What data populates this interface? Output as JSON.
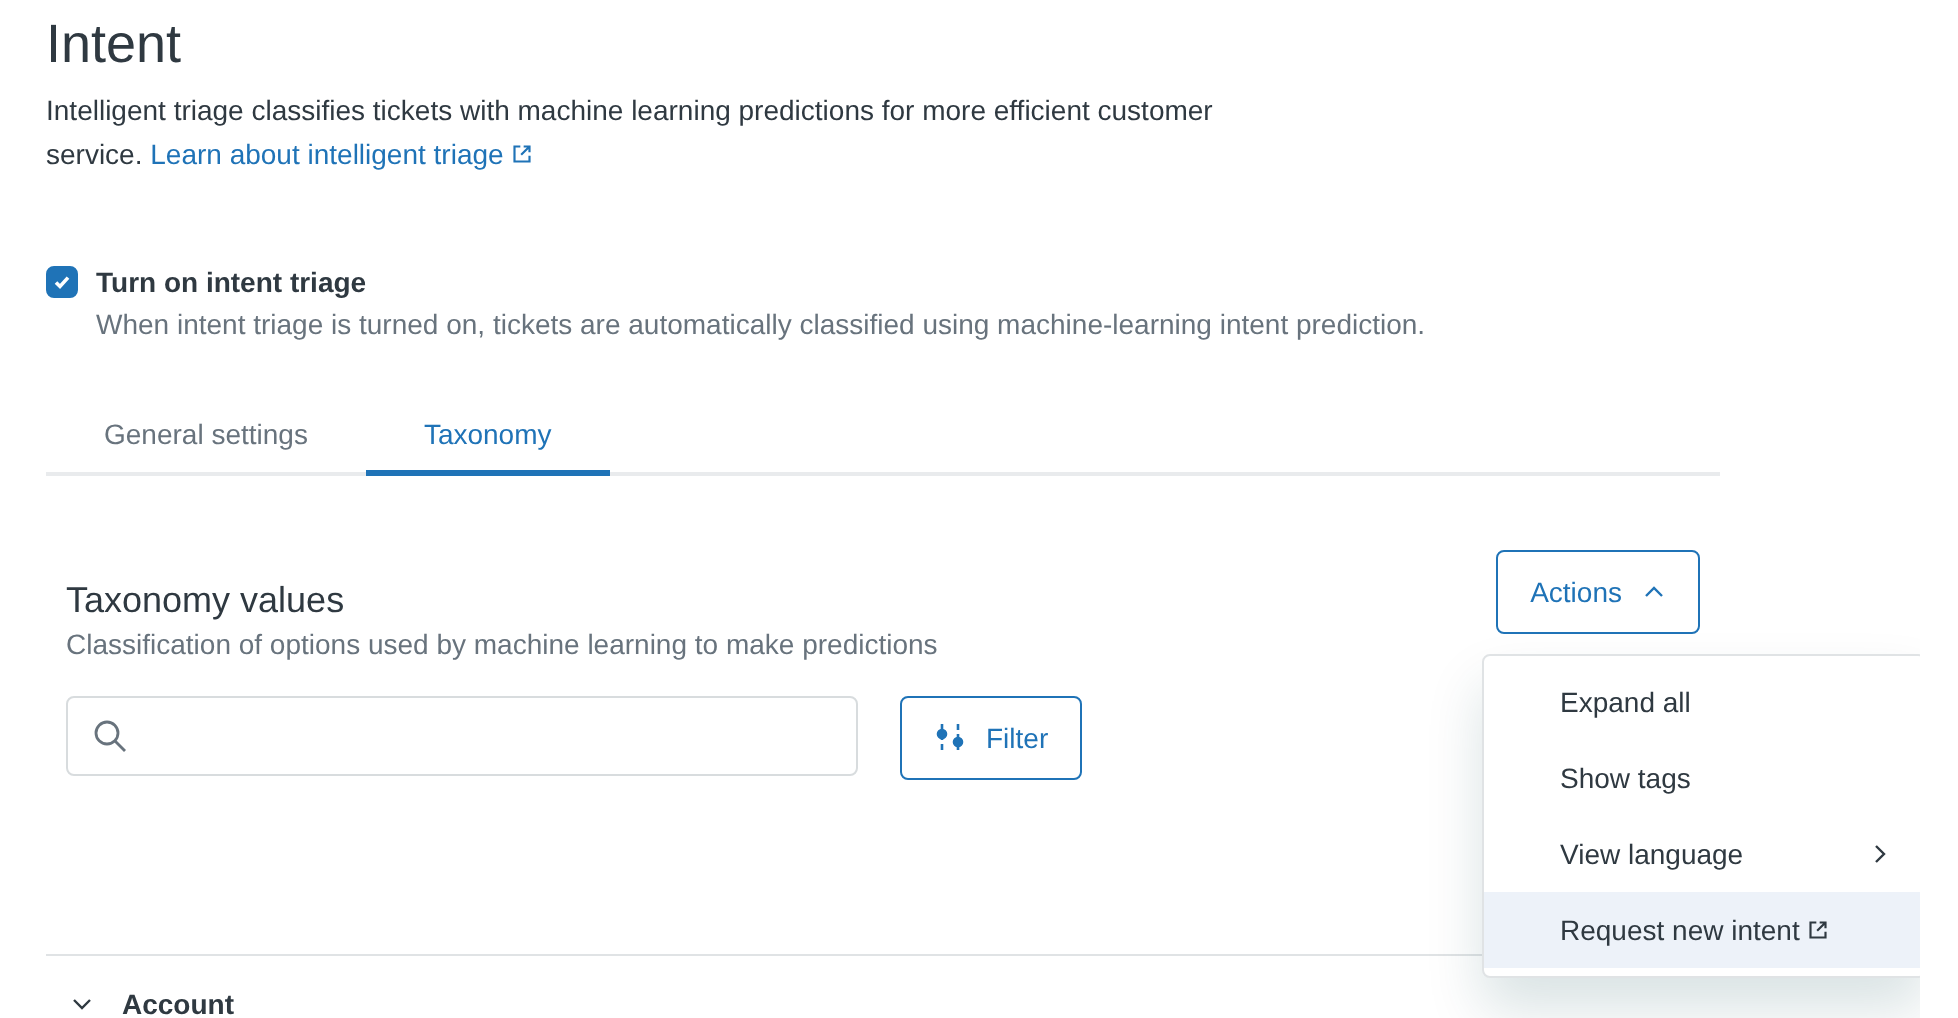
{
  "page": {
    "title": "Intent",
    "description": "Intelligent triage classifies tickets with machine learning predictions for more efficient customer service.",
    "link": "Learn about intelligent triage"
  },
  "setting": {
    "label": "Turn on intent triage",
    "hint": "When intent triage is turned on, tickets are automatically classified using machine-learning intent prediction.",
    "checked": true
  },
  "tabs": [
    {
      "label": "General settings",
      "selected": false
    },
    {
      "label": "Taxonomy",
      "selected": true
    }
  ],
  "section": {
    "title": "Taxonomy values",
    "subtitle": "Classification of options used by machine learning to make predictions"
  },
  "filter_button": "Filter",
  "actions": {
    "label": "Actions",
    "expanded": true
  },
  "menu": [
    {
      "label": "Expand all",
      "kind": "plain",
      "selected": false
    },
    {
      "label": "Show tags",
      "kind": "plain",
      "selected": false
    },
    {
      "label": "View language",
      "kind": "submenu",
      "selected": false
    },
    {
      "label": "Request new intent",
      "kind": "external",
      "selected": true
    }
  ],
  "groups": [
    {
      "label": "Account",
      "expanded": false
    }
  ]
}
